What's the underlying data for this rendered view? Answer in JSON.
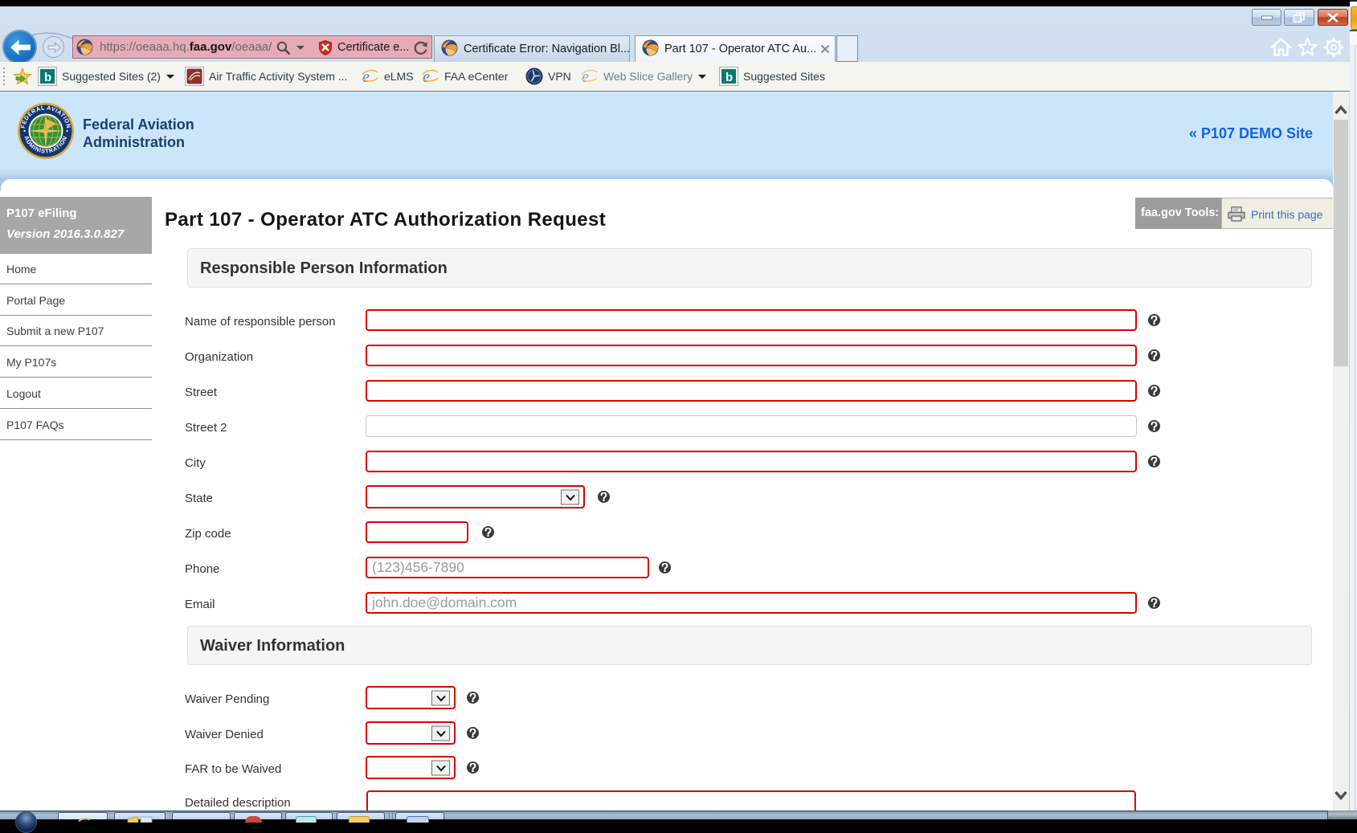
{
  "browser": {
    "address": {
      "url_prefix": "https://oeaaa.hq.",
      "url_domain": "faa.gov",
      "url_suffix": "/oeaaa/",
      "certificate_button": "Certificate e..."
    },
    "tabs": [
      {
        "title": "Certificate Error: Navigation Bl..."
      },
      {
        "title": "Part 107 - Operator ATC Au..."
      }
    ],
    "favorites": {
      "suggested_sites_dd": "Suggested Sites (2)",
      "atas": "Air Traffic Activity System ...",
      "elms": "eLMS",
      "ecenter": "FAA eCenter",
      "vpn": "VPN",
      "web_slice": "Web Slice Gallery",
      "suggested_sites": "Suggested Sites"
    }
  },
  "header": {
    "agency_line1": "Federal Aviation",
    "agency_line2": "Administration",
    "demo_link": "« P107 DEMO Site"
  },
  "sidebar": {
    "app_name": "P107 eFiling",
    "version": "Version 2016.3.0.827",
    "items": [
      {
        "label": "Home"
      },
      {
        "label": "Portal Page"
      },
      {
        "label": "Submit a new P107"
      },
      {
        "label": "My P107s"
      },
      {
        "label": "Logout"
      },
      {
        "label": "P107 FAQs"
      }
    ]
  },
  "main": {
    "page_title": "Part 107 - Operator ATC Authorization Request",
    "tools_label": "faa.gov Tools:",
    "print_label": "Print this page",
    "sections": {
      "responsible": "Responsible Person Information",
      "waiver": "Waiver Information"
    },
    "fields": {
      "name": {
        "label": "Name of responsible person",
        "value": ""
      },
      "organization": {
        "label": "Organization",
        "value": ""
      },
      "street": {
        "label": "Street",
        "value": ""
      },
      "street2": {
        "label": "Street 2",
        "value": ""
      },
      "city": {
        "label": "City",
        "value": ""
      },
      "state": {
        "label": "State",
        "value": ""
      },
      "zip": {
        "label": "Zip code",
        "value": ""
      },
      "phone": {
        "label": "Phone",
        "placeholder": "(123)456-7890",
        "value": ""
      },
      "email": {
        "label": "Email",
        "placeholder": "john.doe@domain.com",
        "value": ""
      },
      "waiver_pending": {
        "label": "Waiver Pending",
        "value": ""
      },
      "waiver_denied": {
        "label": "Waiver Denied",
        "value": ""
      },
      "far_waived": {
        "label": "FAR to be Waived",
        "value": ""
      },
      "detailed_description": {
        "label": "Detailed description",
        "value": ""
      }
    }
  },
  "colors": {
    "required_border": "#dd0000",
    "address_bar_warning": "#e4a9b6",
    "demo_link_blue": "#1263e3",
    "print_link_blue": "#2d73bd"
  }
}
